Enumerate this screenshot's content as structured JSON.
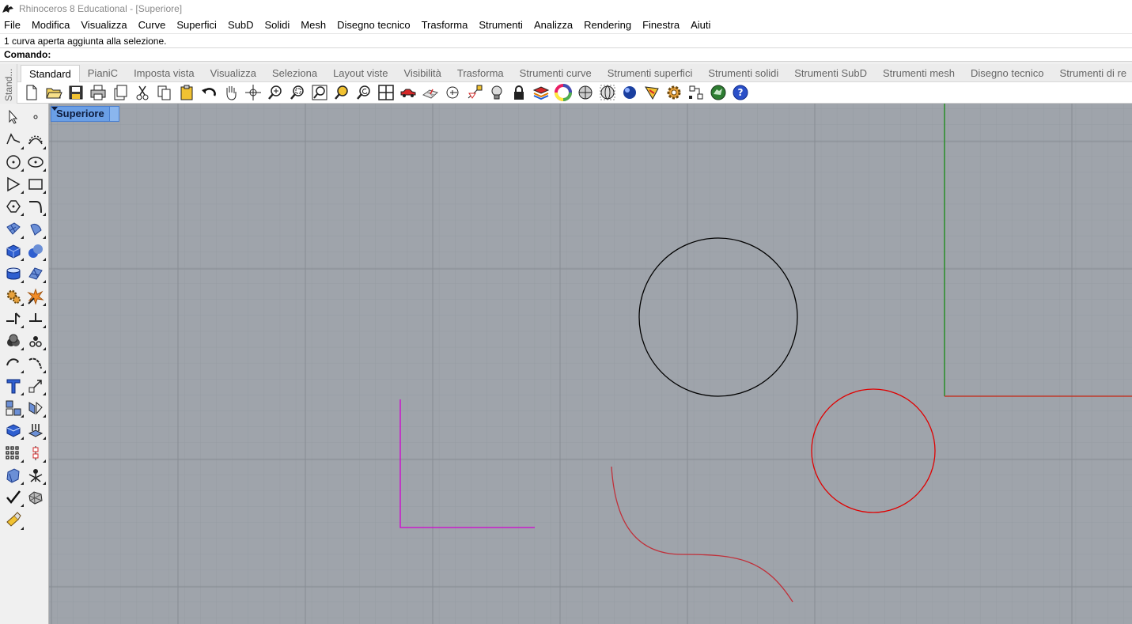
{
  "window": {
    "title": "Rhinoceros 8 Educational - [Superiore]"
  },
  "menu": [
    "File",
    "Modifica",
    "Visualizza",
    "Curve",
    "Superfici",
    "SubD",
    "Solidi",
    "Mesh",
    "Disegno tecnico",
    "Trasforma",
    "Strumenti",
    "Analizza",
    "Rendering",
    "Finestra",
    "Aiuti"
  ],
  "command_history": {
    "previous_line": "- - - - - - -",
    "last_line": "1 curva aperta aggiunta alla selezione."
  },
  "command_prompt": "Comando:",
  "side_grip_label": "Stand...",
  "tabs": [
    "Standard",
    "PianiC",
    "Imposta vista",
    "Visualizza",
    "Seleziona",
    "Layout viste",
    "Visibilità",
    "Trasforma",
    "Strumenti curve",
    "Strumenti superfici",
    "Strumenti solidi",
    "Strumenti SubD",
    "Strumenti mesh",
    "Disegno tecnico",
    "Strumenti di re"
  ],
  "active_tab": "Standard",
  "toolbar_icons": [
    "new-icon",
    "open-icon",
    "save-icon",
    "print-icon",
    "import-icon",
    "cut-icon",
    "copy-icon",
    "paste-icon",
    "undo-icon",
    "pan-icon",
    "rotate-view-icon",
    "zoom-icon",
    "zoom-window-icon",
    "zoom-extents-icon",
    "zoom-selected-icon",
    "undo-view-icon",
    "four-viewports-icon",
    "car-icon",
    "construction-plane-icon",
    "osnap-icon",
    "curve-from-object-icon",
    "light-bulb-icon",
    "lock-icon",
    "layer-icon",
    "color-wheel-icon",
    "shaded-sphere-icon",
    "wireframe-sphere-icon",
    "rendered-sphere-icon",
    "render-icon",
    "settings-gear-icon",
    "grid-snap-icon",
    "rhino-globe-icon",
    "help-icon"
  ],
  "left_tools": [
    "select-arrow-icon",
    "point-icon",
    "polyline-icon",
    "curve-icon",
    "circle-icon",
    "ellipse-icon",
    "polygon-icon",
    "rectangle-icon",
    "arc-icon",
    "fillet-curve-icon",
    "surface-from-points-icon",
    "extrude-surface-icon",
    "box-icon",
    "sphere-icon",
    "cylinder-icon",
    "surface-patch-icon",
    "gear-tool-icon",
    "explode-icon",
    "trim-icon",
    "split-icon",
    "boolean-union-icon",
    "points-cloud-icon",
    "offset-curve-icon",
    "blend-curve-icon",
    "text-icon",
    "scale-icon",
    "group-icon",
    "mirror-icon",
    "block-icon",
    "array-icon",
    "array-grid-icon",
    "align-icon",
    "extrude-solid-icon",
    "gumball-icon",
    "check-icon",
    "mesh-icon",
    "paint-icon"
  ],
  "viewport": {
    "label": "Superiore",
    "bg_color": "#9fa4ab",
    "grid_minor_color": "#979ca3",
    "grid_major_color": "#8a8f96",
    "x_axis_color": "#c0392b",
    "y_axis_color": "#2f8f2f",
    "black_circle_color": "#000000",
    "red_circle_color": "#e00000",
    "polyline_color": "#d100d1",
    "curve_color": "#c0303a"
  }
}
